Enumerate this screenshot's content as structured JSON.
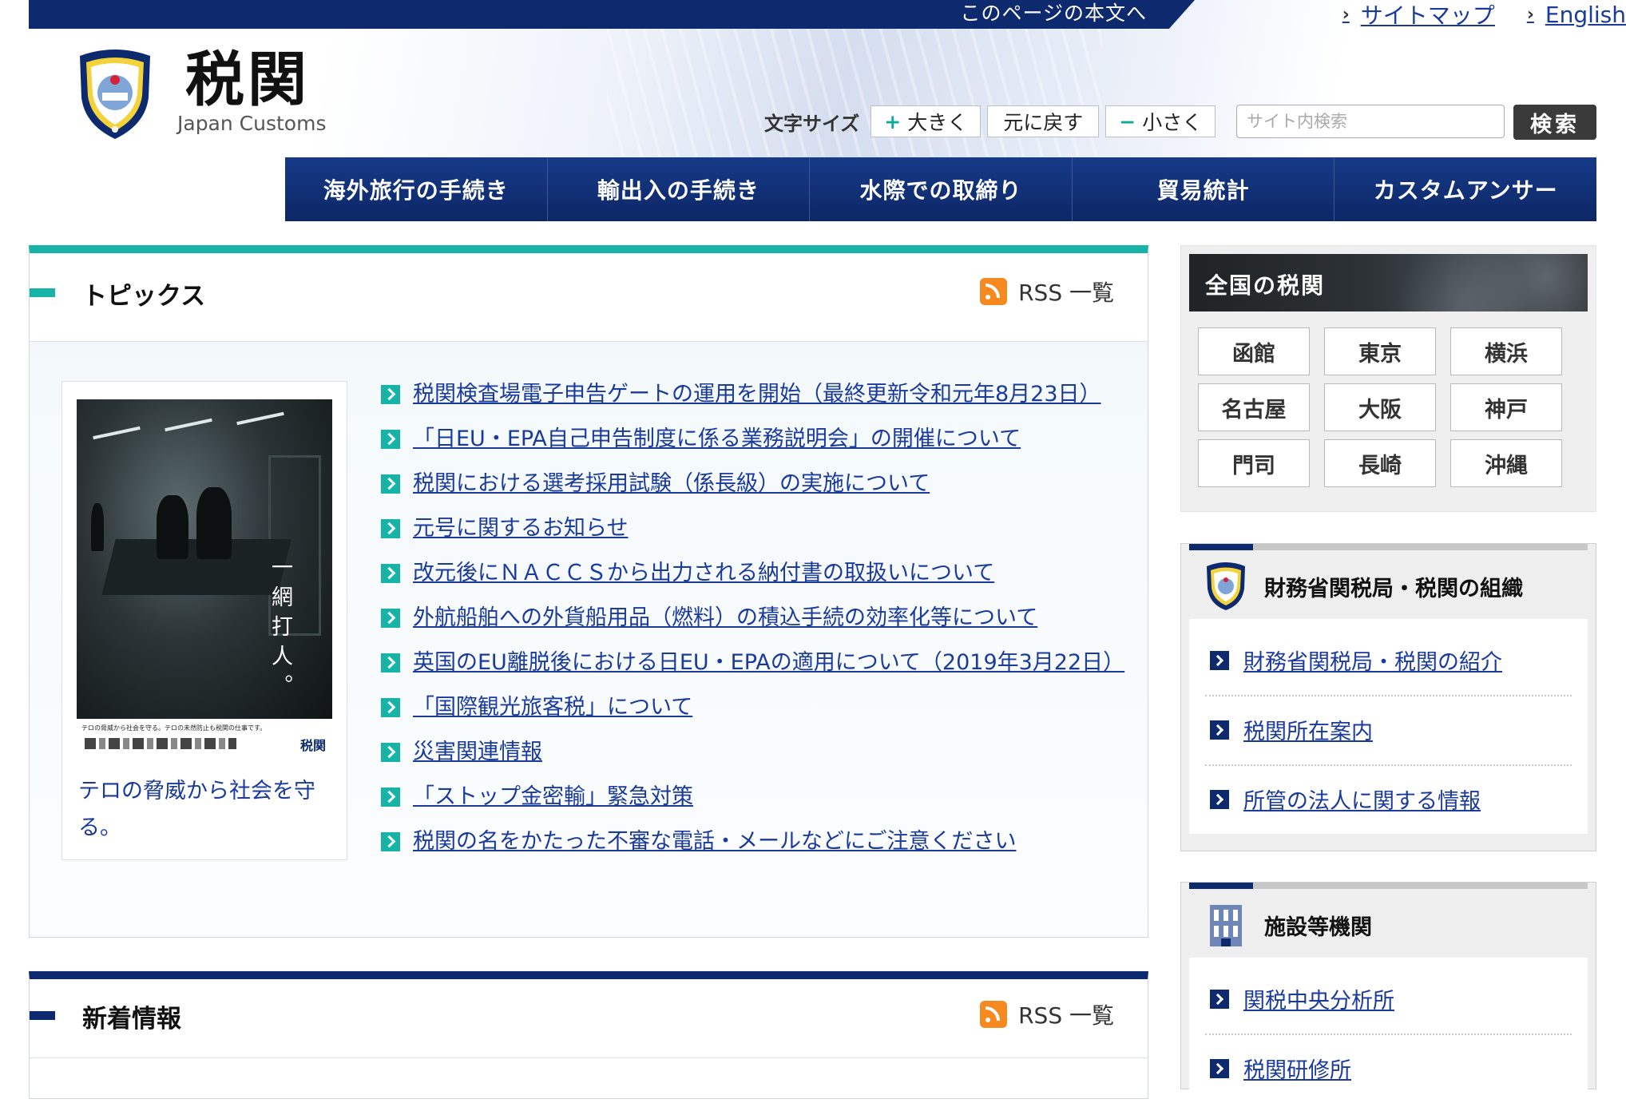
{
  "header": {
    "skip_link": "このページの本文へ",
    "util_links": [
      "サイトマップ",
      "English"
    ],
    "title": "税関",
    "subtitle": "Japan Customs",
    "font_size_label": "文字サイズ",
    "font_size_buttons": [
      {
        "symbol": "+",
        "label": "大きく"
      },
      {
        "symbol": "",
        "label": "元に戻す"
      },
      {
        "symbol": "−",
        "label": "小さく"
      }
    ],
    "search_placeholder": "サイト内検索",
    "search_button": "検索"
  },
  "nav": [
    "海外旅行の手続き",
    "輸出入の手続き",
    "水際での取締り",
    "貿易統計",
    "カスタムアンサー"
  ],
  "topics": {
    "title": "トピックス",
    "rss_label": "RSS 一覧",
    "poster_vertical_text": "一網打人。",
    "poster_footer_text": "テロの脅威から社会を守る。テロの未然防止も税関の仕事です。",
    "poster_logo_text": "税関",
    "poster_caption": "テロの脅威から社会を守る。",
    "items": [
      "税関検査場電子申告ゲートの運用を開始（最終更新令和元年8月23日）",
      "「日EU・EPA自己申告制度に係る業務説明会」の開催について",
      "税関における選考採用試験（係長級）の実施について",
      "元号に関するお知らせ",
      "改元後にＮＡＣＣＳから出力される納付書の取扱いについて",
      "外航船舶への外貨船用品（燃料）の積込手続の効率化等について",
      "英国のEU離脱後における日EU・EPAの適用について（2019年3月22日）",
      "「国際観光旅客税」について",
      "災害関連情報",
      "「ストップ金密輸」緊急対策",
      "税関の名をかたった不審な電話・メールなどにご注意ください"
    ]
  },
  "news": {
    "title": "新着情報",
    "rss_label": "RSS 一覧"
  },
  "sidebar": {
    "customs_title": "全国の税関",
    "offices": [
      "函館",
      "東京",
      "横浜",
      "名古屋",
      "大阪",
      "神戸",
      "門司",
      "長崎",
      "沖縄"
    ],
    "org_panel": {
      "title": "財務省関税局・税関の組織",
      "links": [
        "財務省関税局・税関の紹介",
        "税関所在案内",
        "所管の法人に関する情報"
      ]
    },
    "facility_panel": {
      "title": "施設等機関",
      "links": [
        "関税中央分析所",
        "税関研修所"
      ]
    }
  },
  "colors": {
    "navy": "#0e2a6e",
    "teal": "#17b3a6",
    "link": "#1a3a9c",
    "rss_orange": "#f6891f"
  }
}
